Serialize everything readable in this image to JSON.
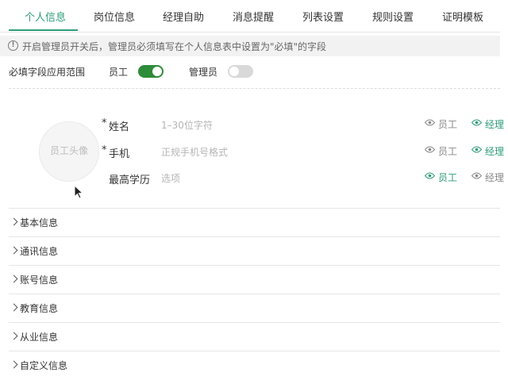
{
  "tabs": [
    {
      "label": "个人信息"
    },
    {
      "label": "岗位信息"
    },
    {
      "label": "经理自助"
    },
    {
      "label": "消息提醒"
    },
    {
      "label": "列表设置"
    },
    {
      "label": "规则设置"
    },
    {
      "label": "证明模板"
    }
  ],
  "notice": {
    "text": "开启管理员开关后，管理员必须填写在个人信息表中设置为\"必填\"的字段",
    "icon": "info-icon"
  },
  "scope": {
    "label": "必填字段应用范围",
    "employee": {
      "label": "员工",
      "enabled": true
    },
    "admin": {
      "label": "管理员",
      "enabled": false
    }
  },
  "avatar": {
    "label": "员工头像"
  },
  "fields": [
    {
      "required_mark": "*",
      "label": "姓名",
      "placeholder": "1–30位字符",
      "employee": "员工",
      "manager": "经理",
      "employee_on": false,
      "manager_on": true
    },
    {
      "required_mark": "*",
      "label": "手机",
      "placeholder": "正规手机号格式",
      "employee": "员工",
      "manager": "经理",
      "employee_on": false,
      "manager_on": true
    },
    {
      "required_mark": "",
      "label": "最高学历",
      "placeholder": "选项",
      "employee": "员工",
      "manager": "经理",
      "employee_on": true,
      "manager_on": false
    }
  ],
  "sections": [
    {
      "label": "基本信息"
    },
    {
      "label": "通讯信息"
    },
    {
      "label": "账号信息"
    },
    {
      "label": "教育信息"
    },
    {
      "label": "从业信息"
    },
    {
      "label": "自定义信息"
    }
  ],
  "colors": {
    "accent": "#2e9c7a",
    "toggle_on": "#2e8b3a",
    "toggle_off": "#d9d9d9"
  }
}
